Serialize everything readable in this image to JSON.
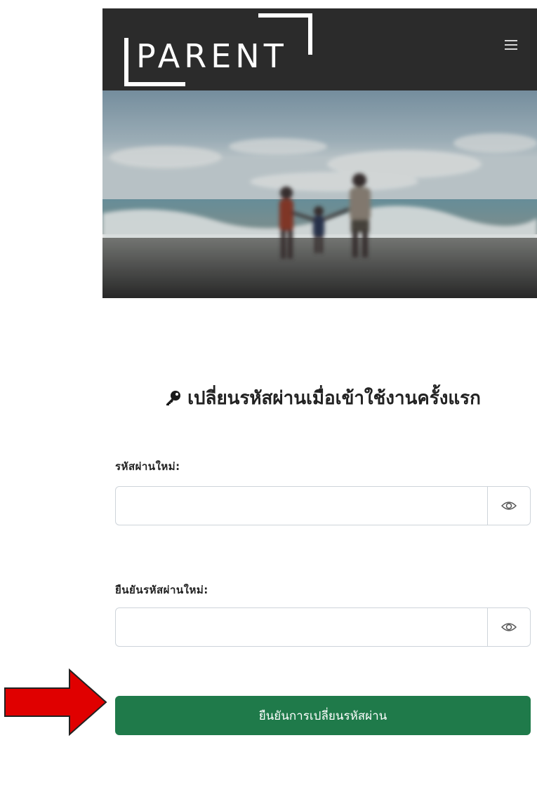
{
  "app": {
    "brand": "PARENT",
    "menu_icon": "hamburger-icon",
    "accent": "#1f7a4a",
    "header_bg": "#2b2b2b"
  },
  "form": {
    "title": "เปลี่ยนรหัสผ่านเมื่อเข้าใช้งานครั้งแรก",
    "title_icon": "key-icon",
    "new_password": {
      "label": "รหัสผ่านใหม่:",
      "value": "",
      "toggle_icon": "eye-icon"
    },
    "confirm_password": {
      "label": "ยืนยันรหัสผ่านใหม่:",
      "value": "",
      "toggle_icon": "eye-icon"
    },
    "submit_label": "ยืนยันการเปลี่ยนรหัสผ่าน"
  },
  "annotation": {
    "pointer_icon": "red-arrow-icon",
    "color": "#e00000"
  }
}
